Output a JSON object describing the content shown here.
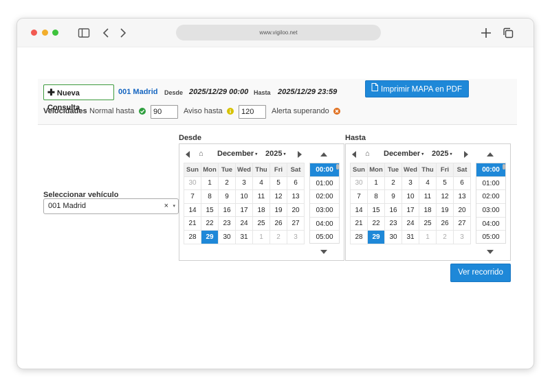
{
  "browser": {
    "url": "www.vigiloo.net"
  },
  "colors": {
    "accent": "#1e88d8",
    "link": "#1565c0",
    "ok": "#2e9e3e",
    "warn": "#d6c200",
    "alert": "#e07020"
  },
  "topbar": {
    "new_query_label": "Nueva Consulta",
    "vehicle_name": "001 Madrid",
    "from_label": "Desde",
    "from_value": "2025/12/29 00:00",
    "to_label": "Hasta",
    "to_value": "2025/12/29 23:59",
    "print_label": "Imprimir MAPA en PDF"
  },
  "speeds": {
    "label": "Velocidades",
    "normal_label": "Normal hasta",
    "normal_value": "90",
    "notice_label": "Aviso hasta",
    "notice_value": "120",
    "alert_label": "Alerta superando"
  },
  "vehicle_select": {
    "label": "Seleccionar vehículo",
    "value": "001 Madrid",
    "clear": "×",
    "arrow": "▾"
  },
  "pickers": [
    {
      "title": "Desde",
      "month": "December",
      "year": "2025",
      "weekdays": [
        "Sun",
        "Mon",
        "Tue",
        "Wed",
        "Thu",
        "Fri",
        "Sat"
      ],
      "weeks": [
        [
          "30",
          "1",
          "2",
          "3",
          "4",
          "5",
          "6"
        ],
        [
          "7",
          "8",
          "9",
          "10",
          "11",
          "12",
          "13"
        ],
        [
          "14",
          "15",
          "16",
          "17",
          "18",
          "19",
          "20"
        ],
        [
          "21",
          "22",
          "23",
          "24",
          "25",
          "26",
          "27"
        ],
        [
          "28",
          "29",
          "30",
          "31",
          "1",
          "2",
          "3"
        ]
      ],
      "selected_day": "29",
      "times": [
        "00:00",
        "01:00",
        "02:00",
        "03:00",
        "04:00",
        "05:00"
      ],
      "selected_time": "00:00"
    },
    {
      "title": "Hasta",
      "month": "December",
      "year": "2025",
      "weekdays": [
        "Sun",
        "Mon",
        "Tue",
        "Wed",
        "Thu",
        "Fri",
        "Sat"
      ],
      "weeks": [
        [
          "30",
          "1",
          "2",
          "3",
          "4",
          "5",
          "6"
        ],
        [
          "7",
          "8",
          "9",
          "10",
          "11",
          "12",
          "13"
        ],
        [
          "14",
          "15",
          "16",
          "17",
          "18",
          "19",
          "20"
        ],
        [
          "21",
          "22",
          "23",
          "24",
          "25",
          "26",
          "27"
        ],
        [
          "28",
          "29",
          "30",
          "31",
          "1",
          "2",
          "3"
        ]
      ],
      "selected_day": "29",
      "times": [
        "00:00",
        "01:00",
        "02:00",
        "03:00",
        "04:00",
        "05:00"
      ],
      "selected_time": "00:00"
    }
  ],
  "route_button_label": "Ver recorrido"
}
